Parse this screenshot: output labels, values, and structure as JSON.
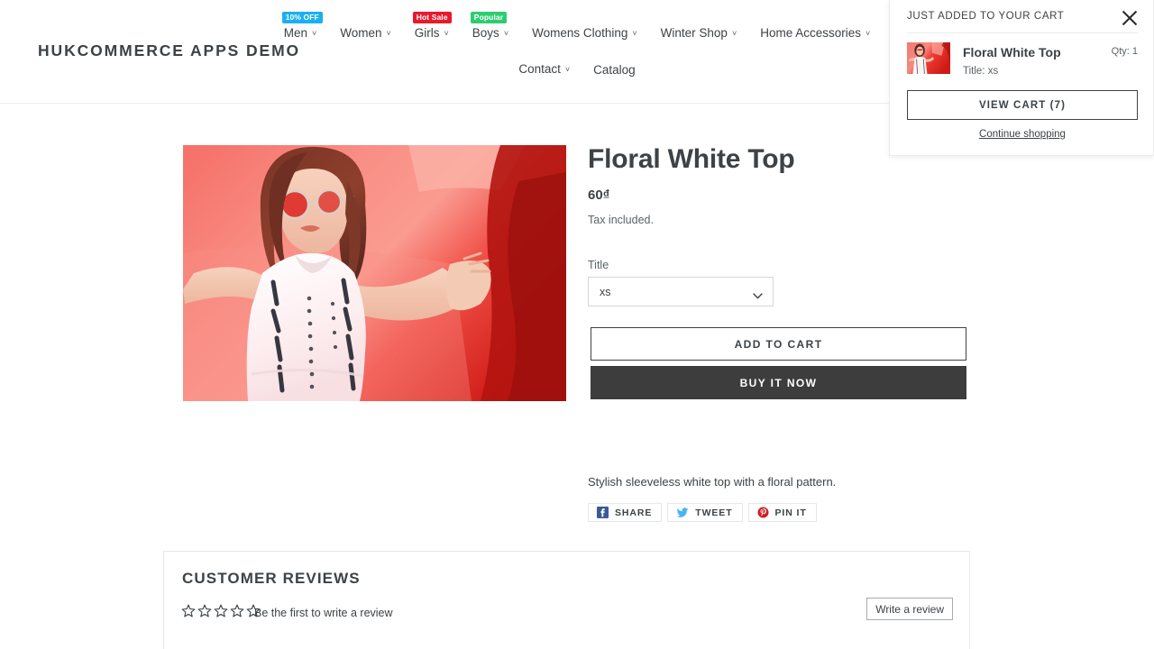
{
  "header": {
    "logo": "HUKCOMMERCE APPS DEMO",
    "nav_row_1": [
      {
        "label": "Men",
        "caret": "˅",
        "badge": "10% OFF",
        "badge_color": "#1ab0f0"
      },
      {
        "label": "Women",
        "caret": "˅",
        "badge": "",
        "badge_color": ""
      },
      {
        "label": "Girls",
        "caret": "˅",
        "badge": "Hot Sale",
        "badge_color": "#e8192c"
      },
      {
        "label": "Boys",
        "caret": "˅",
        "badge": "Popular",
        "badge_color": "#2ecc71"
      },
      {
        "label": "Womens Clothing",
        "caret": "˅",
        "badge": "",
        "badge_color": ""
      },
      {
        "label": "Winter Shop",
        "caret": "˅",
        "badge": "",
        "badge_color": ""
      },
      {
        "label": "Home Accessories",
        "caret": "˅",
        "badge": "",
        "badge_color": ""
      }
    ],
    "nav_row_2": [
      {
        "label": "Contact",
        "caret": "˅",
        "badge": "",
        "badge_color": ""
      },
      {
        "label": "Catalog",
        "caret": "",
        "badge": "",
        "badge_color": ""
      }
    ]
  },
  "cart_popup": {
    "heading": "JUST ADDED TO YOUR CART",
    "close_icon": "close-icon",
    "item": {
      "title": "Floral White Top",
      "variant": "Title: xs",
      "qty": "Qty: 1",
      "thumbnail_alt": "Floral White Top"
    },
    "view_cart_label": "VIEW CART (7)",
    "continue_label": "Continue shopping"
  },
  "product": {
    "title": "Floral White Top",
    "price": "60₫",
    "tax_note": "Tax included.",
    "variant_label": "Title",
    "variant_selected": "xs",
    "variant_options": [
      "xs"
    ],
    "add_to_cart_label": "ADD TO CART",
    "buy_now_label": "BUY IT NOW",
    "description": "Stylish sleeveless white top with a floral pattern.",
    "image_alt": "Woman wearing a white floral sleeveless top against a red backdrop"
  },
  "share": [
    {
      "label": "SHARE",
      "icon": "facebook-icon",
      "color": "#3b5998"
    },
    {
      "label": "TWEET",
      "icon": "twitter-icon",
      "color": "#4ab3f4"
    },
    {
      "label": "PIN IT",
      "icon": "pinterest-icon",
      "color": "#cb2027"
    }
  ],
  "reviews": {
    "heading": "CUSTOMER REVIEWS",
    "rating": 0,
    "max_rating": 5,
    "empty_text": "Be the first to write a review",
    "write_button": "Write a review"
  },
  "colors": {
    "text": "#3d4246",
    "muted": "#5c6266",
    "border": "#e6e7e8",
    "dark_button": "#3d3d3d"
  }
}
